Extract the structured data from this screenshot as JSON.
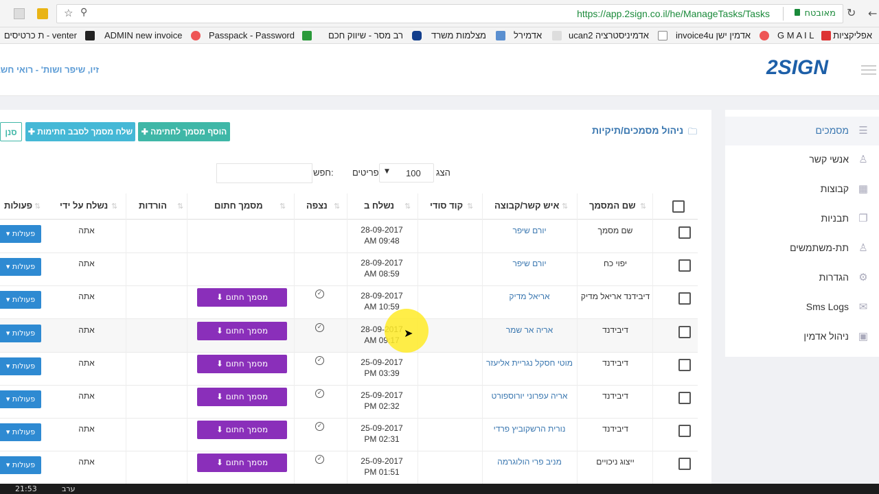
{
  "browser": {
    "url": "https://app.2sign.co.il/he/ManageTasks/Tasks",
    "secure_label": "מאובטח",
    "bookmarks": [
      "אפליקציות",
      "G M A I L",
      "invoice4u אדמין ישן",
      "ucan2 אדמיניסטרציה",
      "אדמירל",
      "מצלמות משרד",
      "רב מסר - שיווק חכם",
      "Passpack - Password",
      "ADMIN new invoice",
      "ת כרטיסים - venter"
    ]
  },
  "header": {
    "logo": "2SIGN",
    "user": "זיו, שיפר ושות' - רואי חשבון"
  },
  "sidebar": {
    "items": [
      {
        "label": "מסמכים",
        "icon": "list-icon"
      },
      {
        "label": "אנשי קשר",
        "icon": "user-icon"
      },
      {
        "label": "קבוצות",
        "icon": "grid-icon"
      },
      {
        "label": "תבניות",
        "icon": "copy-icon"
      },
      {
        "label": "תת-משתמשים",
        "icon": "user-icon"
      },
      {
        "label": "הגדרות",
        "icon": "gear-icon"
      },
      {
        "label": "Sms Logs",
        "icon": "mail-icon"
      },
      {
        "label": "ניהול אדמין",
        "icon": "briefcase-icon"
      }
    ]
  },
  "main": {
    "title": "ניהול מסמכים/תיקיות",
    "add_doc_button": "הוסף מסמך לחתימה",
    "send_doc_button": "שלח מסמך לסבב חתימות",
    "filter_button": "סנן",
    "show_label": "הצג",
    "page_size": "100",
    "items_label": "פריטים",
    "search_label": "חפש:",
    "search_value": ""
  },
  "table": {
    "columns": [
      "שם המסמך",
      "איש קשר/קבוצה",
      "קוד סודי",
      "נשלח ב",
      "נצפה",
      "מסמך חתום",
      "הורדות",
      "נשלח על ידי",
      "פעולות"
    ],
    "actions_label": "פעולות",
    "signed_label": "מסמך חתום",
    "rows": [
      {
        "name": "שם מסמך",
        "contact": "יורם שיפר",
        "date": "28-09-2017",
        "time": "AM 09:48",
        "seen": false,
        "signed": false,
        "sent_by": "אתה"
      },
      {
        "name": "יפוי כח",
        "contact": "יורם שיפר",
        "date": "28-09-2017",
        "time": "AM 08:59",
        "seen": false,
        "signed": false,
        "sent_by": "אתה"
      },
      {
        "name": "דיבידנד אריאל מדיק",
        "contact": "אריאל מדיק",
        "date": "28-09-2017",
        "time": "AM 10:59",
        "seen": true,
        "signed": true,
        "sent_by": "אתה"
      },
      {
        "name": "דיבידנד",
        "contact": "אריה אר שמר",
        "date": "28-09-2017",
        "time": "AM 09:17",
        "seen": true,
        "signed": true,
        "sent_by": "אתה"
      },
      {
        "name": "דיבידנד",
        "contact": "מוטי חסקל נגריית אליעזר",
        "date": "25-09-2017",
        "time": "PM 03:39",
        "seen": true,
        "signed": true,
        "sent_by": "אתה"
      },
      {
        "name": "דיבידנד",
        "contact": "אריה עפרוני יורוספורט",
        "date": "25-09-2017",
        "time": "PM 02:32",
        "seen": true,
        "signed": true,
        "sent_by": "אתה"
      },
      {
        "name": "דיבידנד",
        "contact": "נורית הרשקוביץ פרדי",
        "date": "25-09-2017",
        "time": "PM 02:31",
        "seen": true,
        "signed": true,
        "sent_by": "אתה"
      },
      {
        "name": "ייצוג ניכויים",
        "contact": "מניב פרי הולוגרמה",
        "date": "25-09-2017",
        "time": "PM 01:51",
        "seen": true,
        "signed": true,
        "sent_by": "אתה"
      }
    ]
  },
  "taskbar": {
    "clock": "21:53",
    "lang": "ערב"
  },
  "colors": {
    "accent": "#2e8ad2",
    "teal": "#3fb7a7",
    "cyan": "#45b8d6",
    "purple": "#8a2fba",
    "link": "#3a77b0"
  }
}
